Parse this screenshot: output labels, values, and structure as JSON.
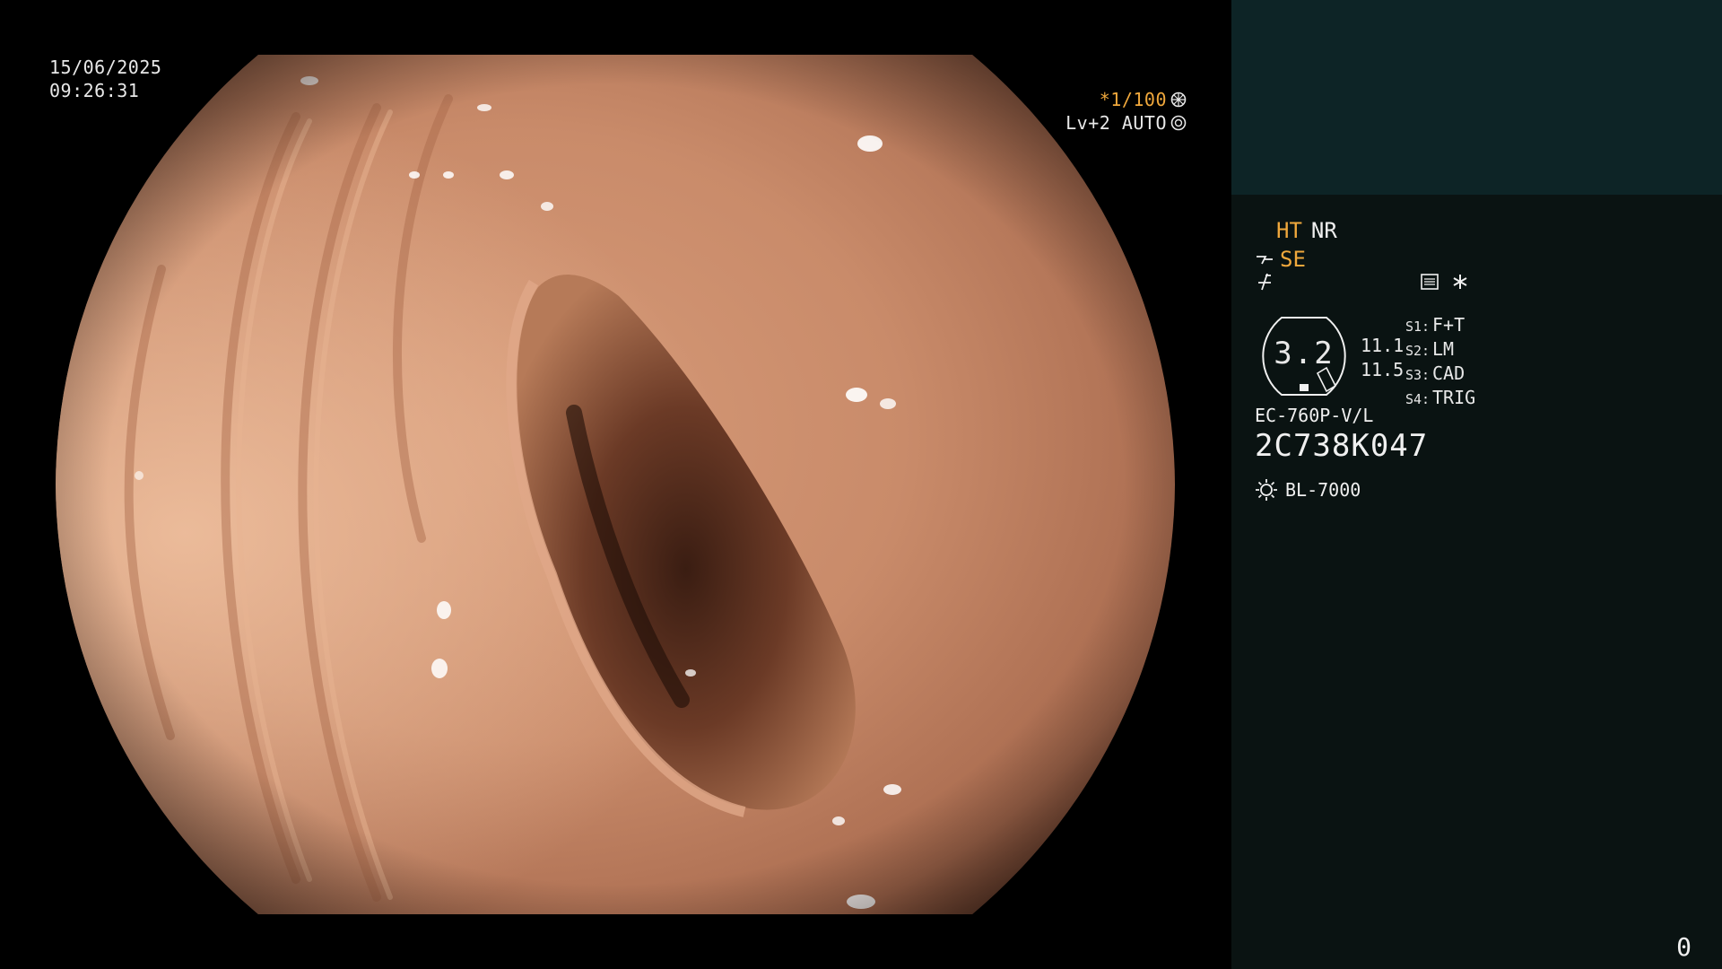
{
  "overlay": {
    "date": "15/06/2025",
    "time": "09:26:31",
    "shutter": "*1/100",
    "level": "Lv+2 AUTO"
  },
  "panel": {
    "mode_primary": "HT",
    "mode_secondary": "NR",
    "structure_enhancement": "SE",
    "gauge_value": "3.2",
    "side_values": [
      "11.1",
      "11.5"
    ],
    "settings": [
      {
        "key": "S1:",
        "value": "F+T"
      },
      {
        "key": "S2:",
        "value": "LM"
      },
      {
        "key": "S3:",
        "value": "CAD"
      },
      {
        "key": "S4:",
        "value": "TRIG"
      }
    ],
    "scope_model": "EC-760P-V/L",
    "serial_number": "2C738K047",
    "light_source": "BL-7000",
    "frame_counter": "0"
  },
  "colors": {
    "accent": "#f0a83c",
    "panel_bg": "#0a1312",
    "panel_top_bg": "#0d2426",
    "text": "#f0f0f0"
  },
  "icons": [
    "shutter-icon",
    "iris-icon",
    "se-icon",
    "f-icon",
    "menu-icon",
    "star-icon",
    "light-source-icon"
  ]
}
